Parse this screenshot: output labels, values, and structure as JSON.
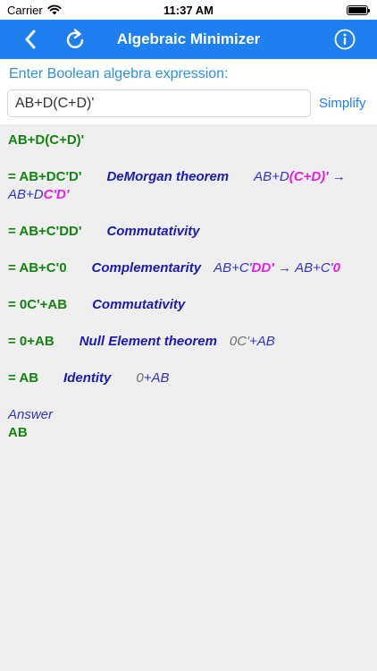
{
  "status_bar": {
    "carrier": "Carrier",
    "time": "11:37 AM"
  },
  "nav": {
    "title": "Algebraic Minimizer",
    "back_icon": "chevron-left-icon",
    "refresh_icon": "refresh-icon",
    "info_icon": "info-icon"
  },
  "input": {
    "prompt": "Enter Boolean algebra expression:",
    "value": "AB+D(C+D)'",
    "simplify_label": "Simplify"
  },
  "steps": {
    "original": "AB+D(C+D)'",
    "s1": {
      "result": "= AB+DC'D'",
      "rule": "DeMorgan theorem",
      "pre": "AB+D",
      "pre_hl": "(C+D)'",
      "arrow": "→",
      "post": "AB+D",
      "post_hl": "C'D'"
    },
    "s2": {
      "result": "= AB+C'DD'",
      "rule": "Commutativity"
    },
    "s3": {
      "result": "= AB+C'0",
      "rule": "Complementarity",
      "pre": "AB+C'",
      "pre_hl": "DD'",
      "arrow": "→",
      "post": "AB+C'",
      "post_hl": "0"
    },
    "s4": {
      "result": "= 0C'+AB",
      "rule": "Commutativity"
    },
    "s5": {
      "result": "= 0+AB",
      "rule": "Null Element theorem",
      "gray": "0C'",
      "rest": "+AB"
    },
    "s6": {
      "result": "= AB",
      "rule": "Identity",
      "gray": "0",
      "rest": "+AB"
    }
  },
  "answer": {
    "label": "Answer",
    "value": "AB"
  },
  "colors": {
    "nav_blue": "#1e7ff0",
    "result_green": "#148214",
    "rule_blue": "#1a1ab4",
    "highlight_magenta": "#e61ee6"
  }
}
